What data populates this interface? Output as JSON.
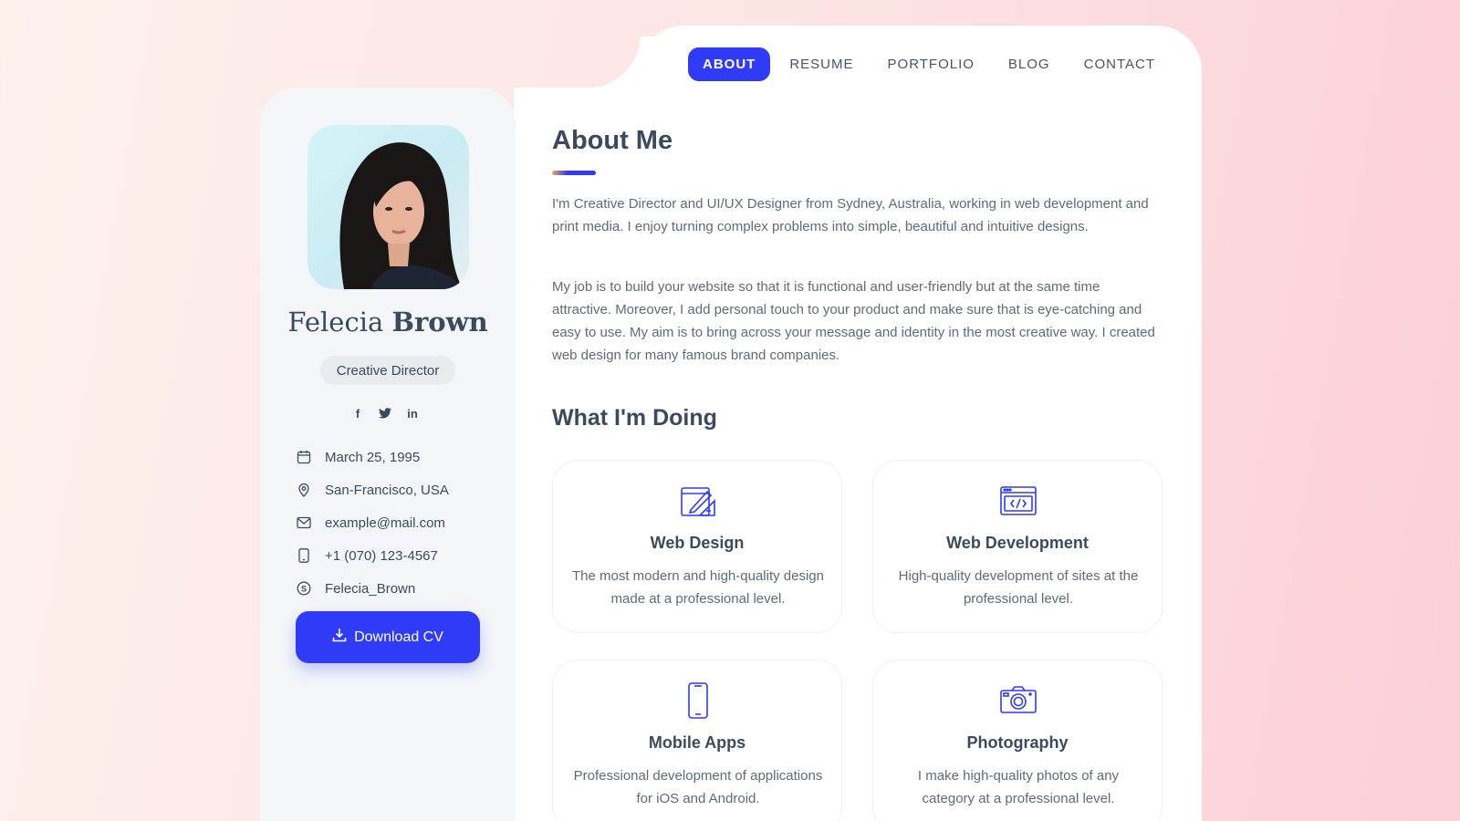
{
  "nav": {
    "items": [
      {
        "label": "ABOUT",
        "active": true
      },
      {
        "label": "RESUME",
        "active": false
      },
      {
        "label": "PORTFOLIO",
        "active": false
      },
      {
        "label": "BLOG",
        "active": false
      },
      {
        "label": "CONTACT",
        "active": false
      }
    ]
  },
  "profile": {
    "first_name": "Felecia",
    "last_name": "Brown",
    "role": "Creative Director",
    "socials": [
      "facebook-icon",
      "twitter-icon",
      "linkedin-icon"
    ],
    "contacts": [
      {
        "icon": "calendar-icon",
        "text": "March 25, 1995"
      },
      {
        "icon": "location-pin-icon",
        "text": "San-Francisco, USA"
      },
      {
        "icon": "mail-icon",
        "text": "example@mail.com"
      },
      {
        "icon": "phone-icon",
        "text": "+1 (070) 123-4567"
      },
      {
        "icon": "skype-icon",
        "text": "Felecia_Brown"
      }
    ],
    "download_label": "Download CV"
  },
  "about": {
    "title": "About Me",
    "paragraphs": [
      "I'm Creative Director and UI/UX Designer from Sydney, Australia, working in web development and print media. I enjoy turning complex problems into simple, beautiful and intuitive designs.",
      "My job is to build your website so that it is functional and user-friendly but at the same time attractive. Moreover, I add personal touch to your product and make sure that is eye-catching and easy to use. My aim is to bring across your message and identity in the most creative way. I created web design for many famous brand companies."
    ]
  },
  "doing": {
    "title": "What I'm Doing",
    "services": [
      {
        "icon": "design-tools-icon",
        "title": "Web Design",
        "desc": "The most modern and high-quality design made at a professional level."
      },
      {
        "icon": "code-window-icon",
        "title": "Web Development",
        "desc": "High-quality development of sites at the professional level."
      },
      {
        "icon": "smartphone-icon",
        "title": "Mobile Apps",
        "desc": "Professional development of applications for iOS and Android."
      },
      {
        "icon": "camera-icon",
        "title": "Photography",
        "desc": "I make high-quality photos of any category at a professional level."
      }
    ]
  },
  "colors": {
    "accent": "#2f3bf7",
    "text": "#3b4a5e",
    "muted": "#5d6b7d",
    "sidebar_bg": "#f4f6f9"
  }
}
